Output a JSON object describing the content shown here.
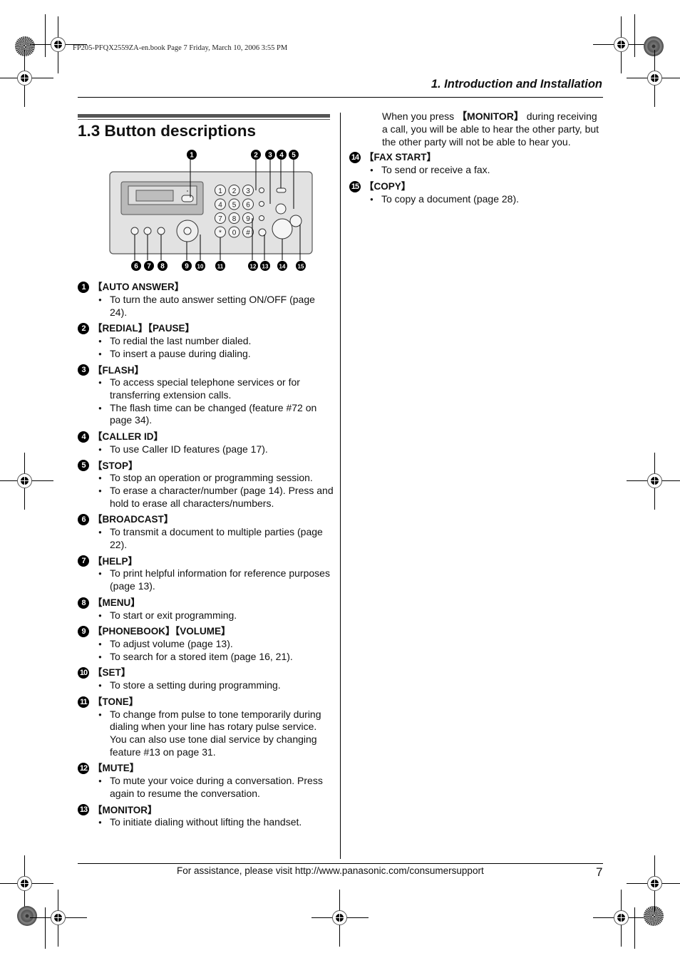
{
  "print_info": "FP205-PFQX2559ZA-en.book  Page 7  Friday, March 10, 2006  3:55 PM",
  "chapter_title": "1. Introduction and Installation",
  "page_title": "1.3 Button descriptions",
  "diagram": {
    "callouts_top": [
      "1",
      "2",
      "3",
      "4",
      "5"
    ],
    "callouts_bottom": [
      "6",
      "7",
      "8",
      "9",
      "10",
      "11",
      "12",
      "13",
      "14",
      "15"
    ],
    "keypad": [
      "1",
      "2",
      "3",
      "4",
      "5",
      "6",
      "7",
      "8",
      "9",
      "*",
      "0",
      "#"
    ]
  },
  "left_items": [
    {
      "num": "1",
      "label": "【AUTO ANSWER】",
      "bullets": [
        "To turn the auto answer setting ON/OFF (page 24)."
      ]
    },
    {
      "num": "2",
      "label": "【REDIAL】【PAUSE】",
      "bullets": [
        "To redial the last number dialed.",
        "To insert a pause during dialing."
      ]
    },
    {
      "num": "3",
      "label": "【FLASH】",
      "bullets": [
        "To access special telephone services or for transferring extension calls.",
        "The flash time can be changed (feature #72 on page 34)."
      ]
    },
    {
      "num": "4",
      "label": "【CALLER ID】",
      "bullets": [
        "To use Caller ID features (page 17)."
      ]
    },
    {
      "num": "5",
      "label": "【STOP】",
      "bullets": [
        "To stop an operation or programming session.",
        "To erase a character/number (page 14). Press and hold to erase all characters/numbers."
      ]
    },
    {
      "num": "6",
      "label": "【BROADCAST】",
      "bullets": [
        "To transmit a document to multiple parties (page 22)."
      ]
    },
    {
      "num": "7",
      "label": "【HELP】",
      "bullets": [
        "To print helpful information for reference purposes (page 13)."
      ]
    },
    {
      "num": "8",
      "label": "【MENU】",
      "bullets": [
        "To start or exit programming."
      ]
    },
    {
      "num": "9",
      "label": "【PHONEBOOK】【VOLUME】",
      "bullets": [
        "To adjust volume (page 13).",
        "To search for a stored item (page 16, 21)."
      ]
    },
    {
      "num": "10",
      "label": "【SET】",
      "bullets": [
        "To store a setting during programming."
      ]
    },
    {
      "num": "11",
      "label": "【TONE】",
      "bullets": [
        "To change from pulse to tone temporarily during dialing when your line has rotary pulse service. You can also use tone dial service by changing feature #13 on page 31."
      ]
    },
    {
      "num": "12",
      "label": "【MUTE】",
      "bullets": [
        "To mute your voice during a conversation. Press again to resume the conversation."
      ]
    },
    {
      "num": "13",
      "label": "【MONITOR】",
      "bullets": [
        "To initiate dialing without lifting the handset."
      ]
    }
  ],
  "right_intro": {
    "before": "When you press ",
    "bold": "【MONITOR】",
    "after": " during receiving a call, you will be able to hear the other party, but the other party will not be able to hear you."
  },
  "right_items": [
    {
      "num": "14",
      "label": "【FAX START】",
      "bullets": [
        "To send or receive a fax."
      ]
    },
    {
      "num": "15",
      "label": "【COPY】",
      "bullets": [
        "To copy a document (page 28)."
      ]
    }
  ],
  "footer": {
    "assistance": "For assistance, please visit http://www.panasonic.com/consumersupport",
    "page_number": "7"
  }
}
